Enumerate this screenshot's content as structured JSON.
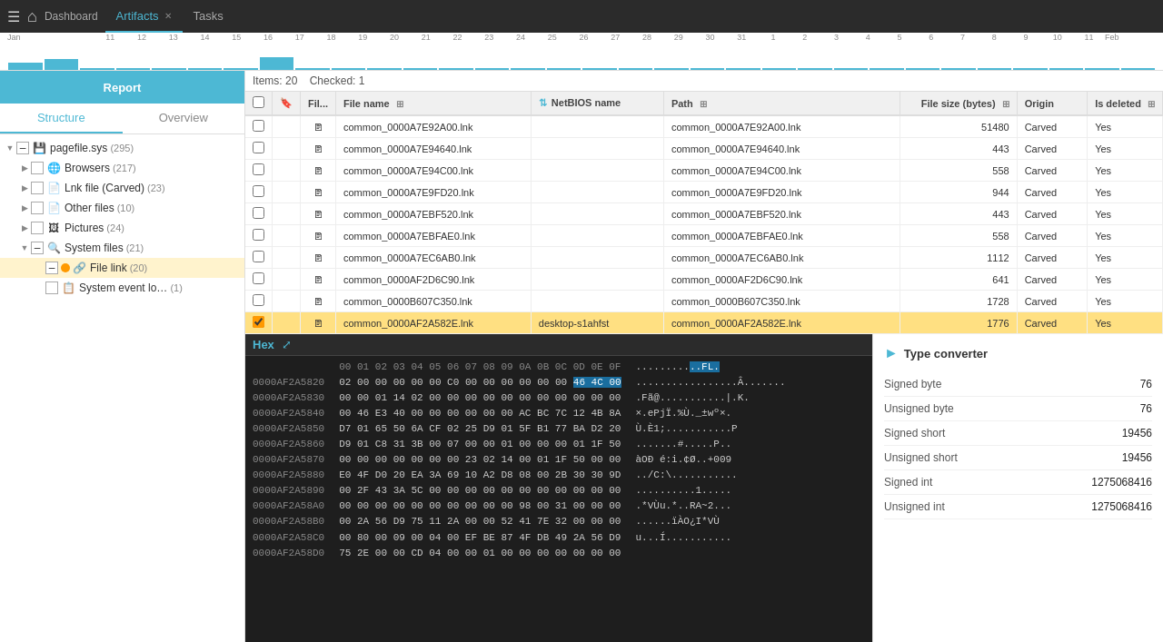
{
  "topbar": {
    "menu_icon": "☰",
    "home_icon": "⌂",
    "dashboard_label": "Dashboard",
    "tab_artifacts": "Artifacts",
    "tab_tasks": "Tasks"
  },
  "timeline": {
    "labels": [
      "11",
      "12",
      "13",
      "14",
      "15",
      "16",
      "17",
      "18",
      "19",
      "20",
      "21",
      "22",
      "23",
      "24",
      "25",
      "26",
      "27",
      "28",
      "29",
      "30",
      "31",
      "1",
      "2",
      "3",
      "4",
      "5",
      "6",
      "7",
      "8",
      "9",
      "10",
      "11"
    ],
    "month_jan": "Jan",
    "month_feb": "Feb",
    "bar_heights": [
      8,
      12,
      2,
      2,
      2,
      2,
      2,
      14,
      2,
      2,
      2,
      2,
      2,
      2,
      2,
      2,
      2,
      2,
      2,
      2,
      2,
      2,
      2,
      2,
      2,
      2,
      2,
      2,
      2,
      2,
      2,
      2
    ]
  },
  "sidebar": {
    "tab_structure": "Structure",
    "tab_overview": "Overview",
    "tree": [
      {
        "id": "pagefile",
        "label": "pagefile.sys",
        "count": "(295)",
        "level": 0,
        "expanded": true,
        "checked": "indeterminate"
      },
      {
        "id": "browsers",
        "label": "Browsers",
        "count": "(217)",
        "level": 1,
        "expanded": false,
        "checked": false
      },
      {
        "id": "lnk",
        "label": "Lnk file (Carved)",
        "count": "(23)",
        "level": 1,
        "expanded": false,
        "checked": false
      },
      {
        "id": "otherfiles",
        "label": "Other files",
        "count": "(10)",
        "level": 1,
        "expanded": false,
        "checked": false
      },
      {
        "id": "pictures",
        "label": "Pictures",
        "count": "(24)",
        "level": 1,
        "expanded": false,
        "checked": false
      },
      {
        "id": "systemfiles",
        "label": "System files",
        "count": "(21)",
        "level": 1,
        "expanded": true,
        "checked": "indeterminate"
      },
      {
        "id": "filelink",
        "label": "File link",
        "count": "(20)",
        "level": 2,
        "expanded": false,
        "checked": "indeterminate",
        "selected": true
      },
      {
        "id": "systemevent",
        "label": "System event lo…",
        "count": "(1)",
        "level": 2,
        "expanded": false,
        "checked": false
      }
    ]
  },
  "report_button": "Report",
  "content": {
    "items_label": "Items: 20",
    "checked_label": "Checked: 1",
    "columns": [
      {
        "key": "check",
        "label": ""
      },
      {
        "key": "bookmark",
        "label": ""
      },
      {
        "key": "filetype",
        "label": "Fil..."
      },
      {
        "key": "filename",
        "label": "File name"
      },
      {
        "key": "netbios",
        "label": "NetBIOS name"
      },
      {
        "key": "path",
        "label": "Path"
      },
      {
        "key": "filesize",
        "label": "File size (bytes)"
      },
      {
        "key": "origin",
        "label": "Origin"
      },
      {
        "key": "isdeleted",
        "label": "Is deleted"
      }
    ],
    "rows": [
      {
        "filename": "common_0000A7E92A00.lnk",
        "netbios": "",
        "path": "common_0000A7E92A00.lnk",
        "filesize": "51480",
        "origin": "Carved",
        "isdeleted": "Yes",
        "selected": false
      },
      {
        "filename": "common_0000A7E94640.lnk",
        "netbios": "",
        "path": "common_0000A7E94640.lnk",
        "filesize": "443",
        "origin": "Carved",
        "isdeleted": "Yes",
        "selected": false
      },
      {
        "filename": "common_0000A7E94C00.lnk",
        "netbios": "",
        "path": "common_0000A7E94C00.lnk",
        "filesize": "558",
        "origin": "Carved",
        "isdeleted": "Yes",
        "selected": false
      },
      {
        "filename": "common_0000A7E9FD20.lnk",
        "netbios": "",
        "path": "common_0000A7E9FD20.lnk",
        "filesize": "944",
        "origin": "Carved",
        "isdeleted": "Yes",
        "selected": false
      },
      {
        "filename": "common_0000A7EBF520.lnk",
        "netbios": "",
        "path": "common_0000A7EBF520.lnk",
        "filesize": "443",
        "origin": "Carved",
        "isdeleted": "Yes",
        "selected": false
      },
      {
        "filename": "common_0000A7EBFAE0.lnk",
        "netbios": "",
        "path": "common_0000A7EBFAE0.lnk",
        "filesize": "558",
        "origin": "Carved",
        "isdeleted": "Yes",
        "selected": false
      },
      {
        "filename": "common_0000A7EC6AB0.lnk",
        "netbios": "",
        "path": "common_0000A7EC6AB0.lnk",
        "filesize": "1112",
        "origin": "Carved",
        "isdeleted": "Yes",
        "selected": false
      },
      {
        "filename": "common_0000AF2D6C90.lnk",
        "netbios": "",
        "path": "common_0000AF2D6C90.lnk",
        "filesize": "641",
        "origin": "Carved",
        "isdeleted": "Yes",
        "selected": false
      },
      {
        "filename": "common_0000B607C350.lnk",
        "netbios": "",
        "path": "common_0000B607C350.lnk",
        "filesize": "1728",
        "origin": "Carved",
        "isdeleted": "Yes",
        "selected": false
      },
      {
        "filename": "common_0000AF2A582E.lnk",
        "netbios": "desktop-s1ahfst",
        "path": "common_0000AF2A582E.lnk",
        "filesize": "1776",
        "origin": "Carved",
        "isdeleted": "Yes",
        "selected": true
      }
    ]
  },
  "hex": {
    "tab_label": "Hex",
    "header": "00 01 02 03 04 05 06 07 08 09 0A 0B 0C 0D 0E 0F",
    "rows": [
      {
        "addr": "0000AF2A5820",
        "bytes": "02 00 00 00 00 00 C0 00 00 00 00 00 00 46 4C 00",
        "ascii": "..........F...FL."
      },
      {
        "addr": "0000AF2A5830",
        "bytes": "00 00 01 14 02 00 00 00 00 00 00 00 00 00 00 00",
        "ascii": ".................Â......."
      },
      {
        "addr": "0000AF2A5840",
        "bytes": "00 46 E3 40 00 00 00 00 00 00 AC BC 7C 12 4B 8A",
        "ascii": ".Fã@...........|.K."
      },
      {
        "addr": "0000AF2A5850",
        "bytes": "D7 01 65 50 6A CF 02 25 D9 01 5F B1 77 BA D2 20",
        "ascii": "×.ePjÏ.%Ù._±wº×."
      },
      {
        "addr": "0000AF2A5860",
        "bytes": "D9 01 C8 31 3B 00 07 00 00 01 00 00 00 01 1F 50",
        "ascii": "Ù.È1;...........P"
      },
      {
        "addr": "0000AF2A5870",
        "bytes": "00 00 00 00 00 00 00 23 02 14 00 01 1F 50 00 00",
        "ascii": ".......#.....P.."
      },
      {
        "addr": "0000AF2A5880",
        "bytes": "E0 4F D0 20 EA 3A 69 10 A2 D8 08 00 2B 30 30 9D",
        "ascii": "àOÐ é:i.¢Ø..+009"
      },
      {
        "addr": "0000AF2A5890",
        "bytes": "00 2F 43 3A 5C 00 00 00 00 00 00 00 00 00 00 00",
        "ascii": "../C:\\..........."
      },
      {
        "addr": "0000AF2A58A0",
        "bytes": "00 00 00 00 00 00 00 00 00 00 98 00 31 00 00 00",
        "ascii": "..........1....."
      },
      {
        "addr": "0000AF2A58B0",
        "bytes": "00 2A 56 D9 75 11 2A 00 00 52 41 7E 32 00 00 00",
        "ascii": ".*VÙu.*..RA~2..."
      },
      {
        "addr": "0000AF2A58C0",
        "bytes": "00 80 00 09 00 04 00 EF BE 87 4F DB 49 2A 56 D9",
        "ascii": "......ïÀO¿I*VÙ"
      },
      {
        "addr": "0000AF2A58D0",
        "bytes": "75 2E 00 00 CD 04 00 00 01 00 00 00 00 00 00 00",
        "ascii": "u...Í..........."
      }
    ],
    "highlighted_row_index": 0,
    "highlighted_col_start": 13,
    "highlighted_col_end": 15
  },
  "type_converter": {
    "title": "Type converter",
    "fields": [
      {
        "label": "Signed byte",
        "value": "76"
      },
      {
        "label": "Unsigned byte",
        "value": "76"
      },
      {
        "label": "Signed short",
        "value": "19456"
      },
      {
        "label": "Unsigned short",
        "value": "19456"
      },
      {
        "label": "Signed int",
        "value": "1275068416"
      },
      {
        "label": "Unsigned int",
        "value": "1275068416"
      }
    ]
  }
}
